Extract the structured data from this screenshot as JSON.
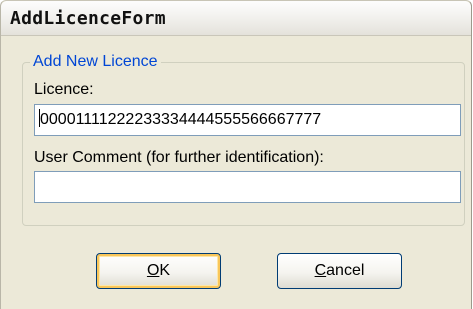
{
  "window": {
    "title": "AddLicenceForm"
  },
  "group": {
    "legend": "Add New Licence"
  },
  "licence": {
    "label": "Licence:",
    "value": "00001111222233334444555566667777"
  },
  "comment": {
    "label": "User Comment (for further identification):",
    "value": ""
  },
  "buttons": {
    "ok": {
      "mnemonic": "O",
      "rest": "K"
    },
    "cancel": {
      "mnemonic": "C",
      "rest": "ancel"
    }
  }
}
